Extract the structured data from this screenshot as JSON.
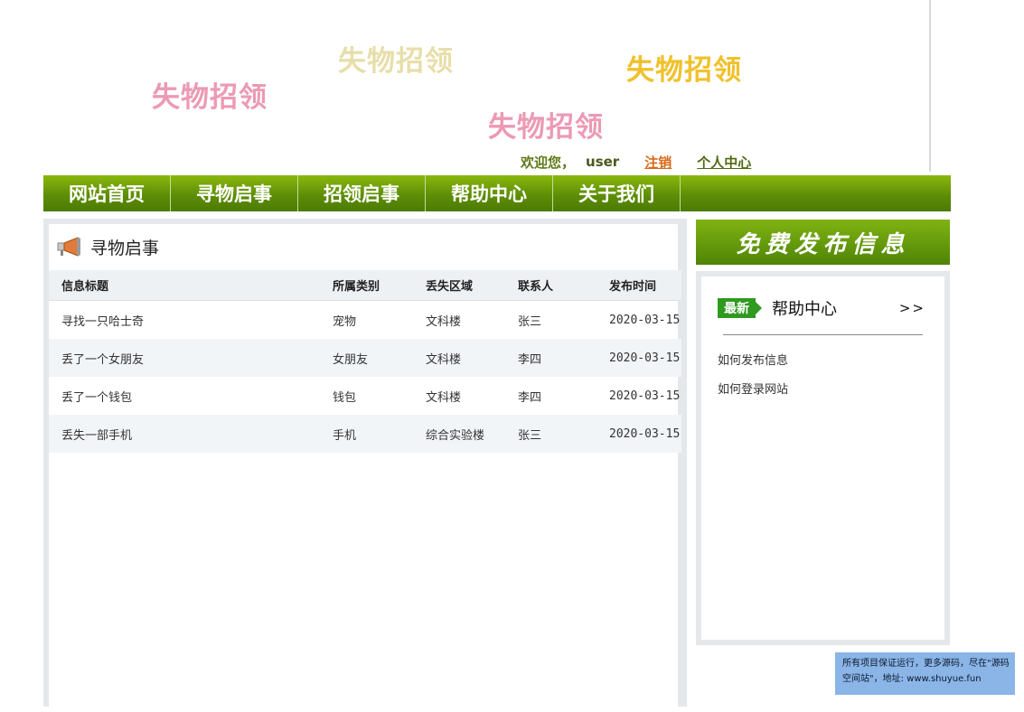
{
  "banner": {
    "decorations": [
      "失物招领",
      "失物招领",
      "失物招领",
      "失物招领"
    ]
  },
  "userbar": {
    "welcome": "欢迎您，",
    "username": "user",
    "logout": "注销",
    "user_center": "个人中心"
  },
  "nav": {
    "items": [
      "网站首页",
      "寻物启事",
      "招领启事",
      "帮助中心",
      "关于我们"
    ]
  },
  "main": {
    "section_title": "寻物启事",
    "columns": [
      "信息标题",
      "所属类别",
      "丢失区域",
      "联系人",
      "发布时间"
    ],
    "rows": [
      [
        "寻找一只哈士奇",
        "宠物",
        "文科楼",
        "张三",
        "2020-03-15"
      ],
      [
        "丢了一个女朋友",
        "女朋友",
        "文科楼",
        "李四",
        "2020-03-15"
      ],
      [
        "丢了一个钱包",
        "钱包",
        "文科楼",
        "李四",
        "2020-03-15"
      ],
      [
        "丢失一部手机",
        "手机",
        "综合实验楼",
        "张三",
        "2020-03-15"
      ]
    ]
  },
  "sidebar": {
    "publish_button": "免费发布信息",
    "badge": "最新",
    "title": "帮助中心",
    "more": ">>",
    "links": [
      "如何发布信息",
      "如何登录网站"
    ]
  },
  "footer_note": "所有项目保证运行，更多源码，尽在\"源码空间站\"，地址: www.shuyue.fun",
  "colors": {
    "nav_green": "#5e8e06",
    "badge_green": "#2f9a1f",
    "logout_orange": "#d86a1b"
  }
}
